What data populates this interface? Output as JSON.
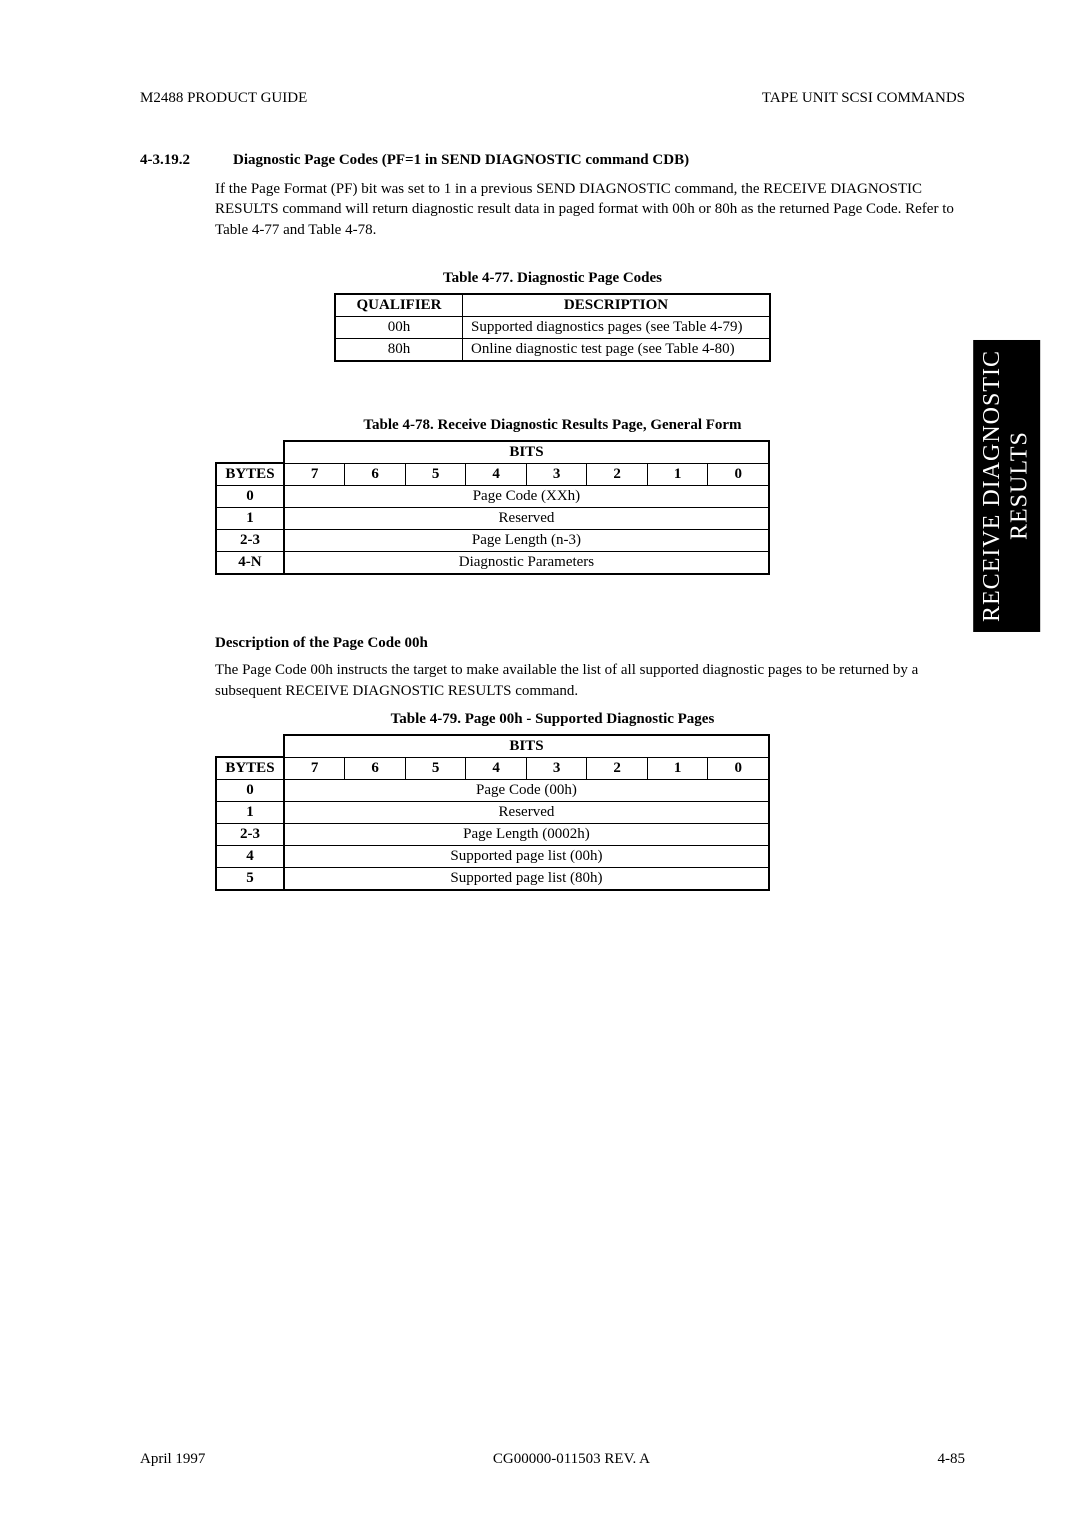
{
  "header": {
    "left": "M2488 PRODUCT GUIDE",
    "right": "TAPE UNIT SCSI COMMANDS"
  },
  "section": {
    "number": "4-3.19.2",
    "title": "Diagnostic Page Codes (PF=1 in SEND DIAGNOSTIC command CDB)",
    "paragraph": "If the Page Format (PF) bit was set to 1 in a previous SEND DIAGNOSTIC command, the RECEIVE DIAGNOSTIC RESULTS command will return diagnostic result data in paged format with 00h or 80h as the returned Page Code. Refer to Table 4-77 and Table 4-78."
  },
  "table77": {
    "caption": "Table 4-77.   Diagnostic Page Codes",
    "headers": {
      "qualifier": "QUALIFIER",
      "description": "DESCRIPTION"
    },
    "rows": [
      {
        "qualifier": "00h",
        "description": "Supported diagnostics pages (see Table 4-79)"
      },
      {
        "qualifier": "80h",
        "description": "Online diagnostic test page (see Table 4-80)"
      }
    ]
  },
  "table78": {
    "caption": "Table 4-78.   Receive Diagnostic Results Page, General Form",
    "bits_label": "BITS",
    "bytes_label": "BYTES",
    "bit_numbers": [
      "7",
      "6",
      "5",
      "4",
      "3",
      "2",
      "1",
      "0"
    ],
    "rows": [
      {
        "byte": "0",
        "value": "Page Code (XXh)"
      },
      {
        "byte": "1",
        "value": "Reserved"
      },
      {
        "byte": "2-3",
        "value": "Page Length (n-3)"
      },
      {
        "byte": "4-N",
        "value": "Diagnostic Parameters"
      }
    ]
  },
  "desc00": {
    "heading": "Description of the Page Code 00h",
    "paragraph": "The Page Code 00h instructs the target to make available the list of all supported diagnostic pages to be returned by a subsequent RECEIVE DIAGNOSTIC RESULTS command."
  },
  "table79": {
    "caption": "Table 4-79.   Page 00h - Supported Diagnostic Pages",
    "bits_label": "BITS",
    "bytes_label": "BYTES",
    "bit_numbers": [
      "7",
      "6",
      "5",
      "4",
      "3",
      "2",
      "1",
      "0"
    ],
    "rows": [
      {
        "byte": "0",
        "value": "Page Code (00h)"
      },
      {
        "byte": "1",
        "value": "Reserved"
      },
      {
        "byte": "2-3",
        "value": "Page Length (0002h)"
      },
      {
        "byte": "4",
        "value": "Supported page list (00h)"
      },
      {
        "byte": "5",
        "value": "Supported page list (80h)"
      }
    ]
  },
  "side_tab": {
    "line1": "RECEIVE DIAGNOSTIC",
    "line2": "RESULTS"
  },
  "footer": {
    "left": "April 1997",
    "center": "CG00000-011503 REV. A",
    "right": "4-85"
  },
  "chart_data": [
    {
      "type": "table",
      "title": "Table 4-77. Diagnostic Page Codes",
      "columns": [
        "QUALIFIER",
        "DESCRIPTION"
      ],
      "rows": [
        [
          "00h",
          "Supported diagnostics pages (see Table 4-79)"
        ],
        [
          "80h",
          "Online diagnostic test page (see Table 4-80)"
        ]
      ]
    },
    {
      "type": "table",
      "title": "Table 4-78. Receive Diagnostic Results Page, General Form",
      "columns": [
        "BYTES",
        "BITS 7-0"
      ],
      "rows": [
        [
          "0",
          "Page Code (XXh)"
        ],
        [
          "1",
          "Reserved"
        ],
        [
          "2-3",
          "Page Length (n-3)"
        ],
        [
          "4-N",
          "Diagnostic Parameters"
        ]
      ]
    },
    {
      "type": "table",
      "title": "Table 4-79. Page 00h - Supported Diagnostic Pages",
      "columns": [
        "BYTES",
        "BITS 7-0"
      ],
      "rows": [
        [
          "0",
          "Page Code (00h)"
        ],
        [
          "1",
          "Reserved"
        ],
        [
          "2-3",
          "Page Length (0002h)"
        ],
        [
          "4",
          "Supported page list (00h)"
        ],
        [
          "5",
          "Supported page list (80h)"
        ]
      ]
    }
  ]
}
